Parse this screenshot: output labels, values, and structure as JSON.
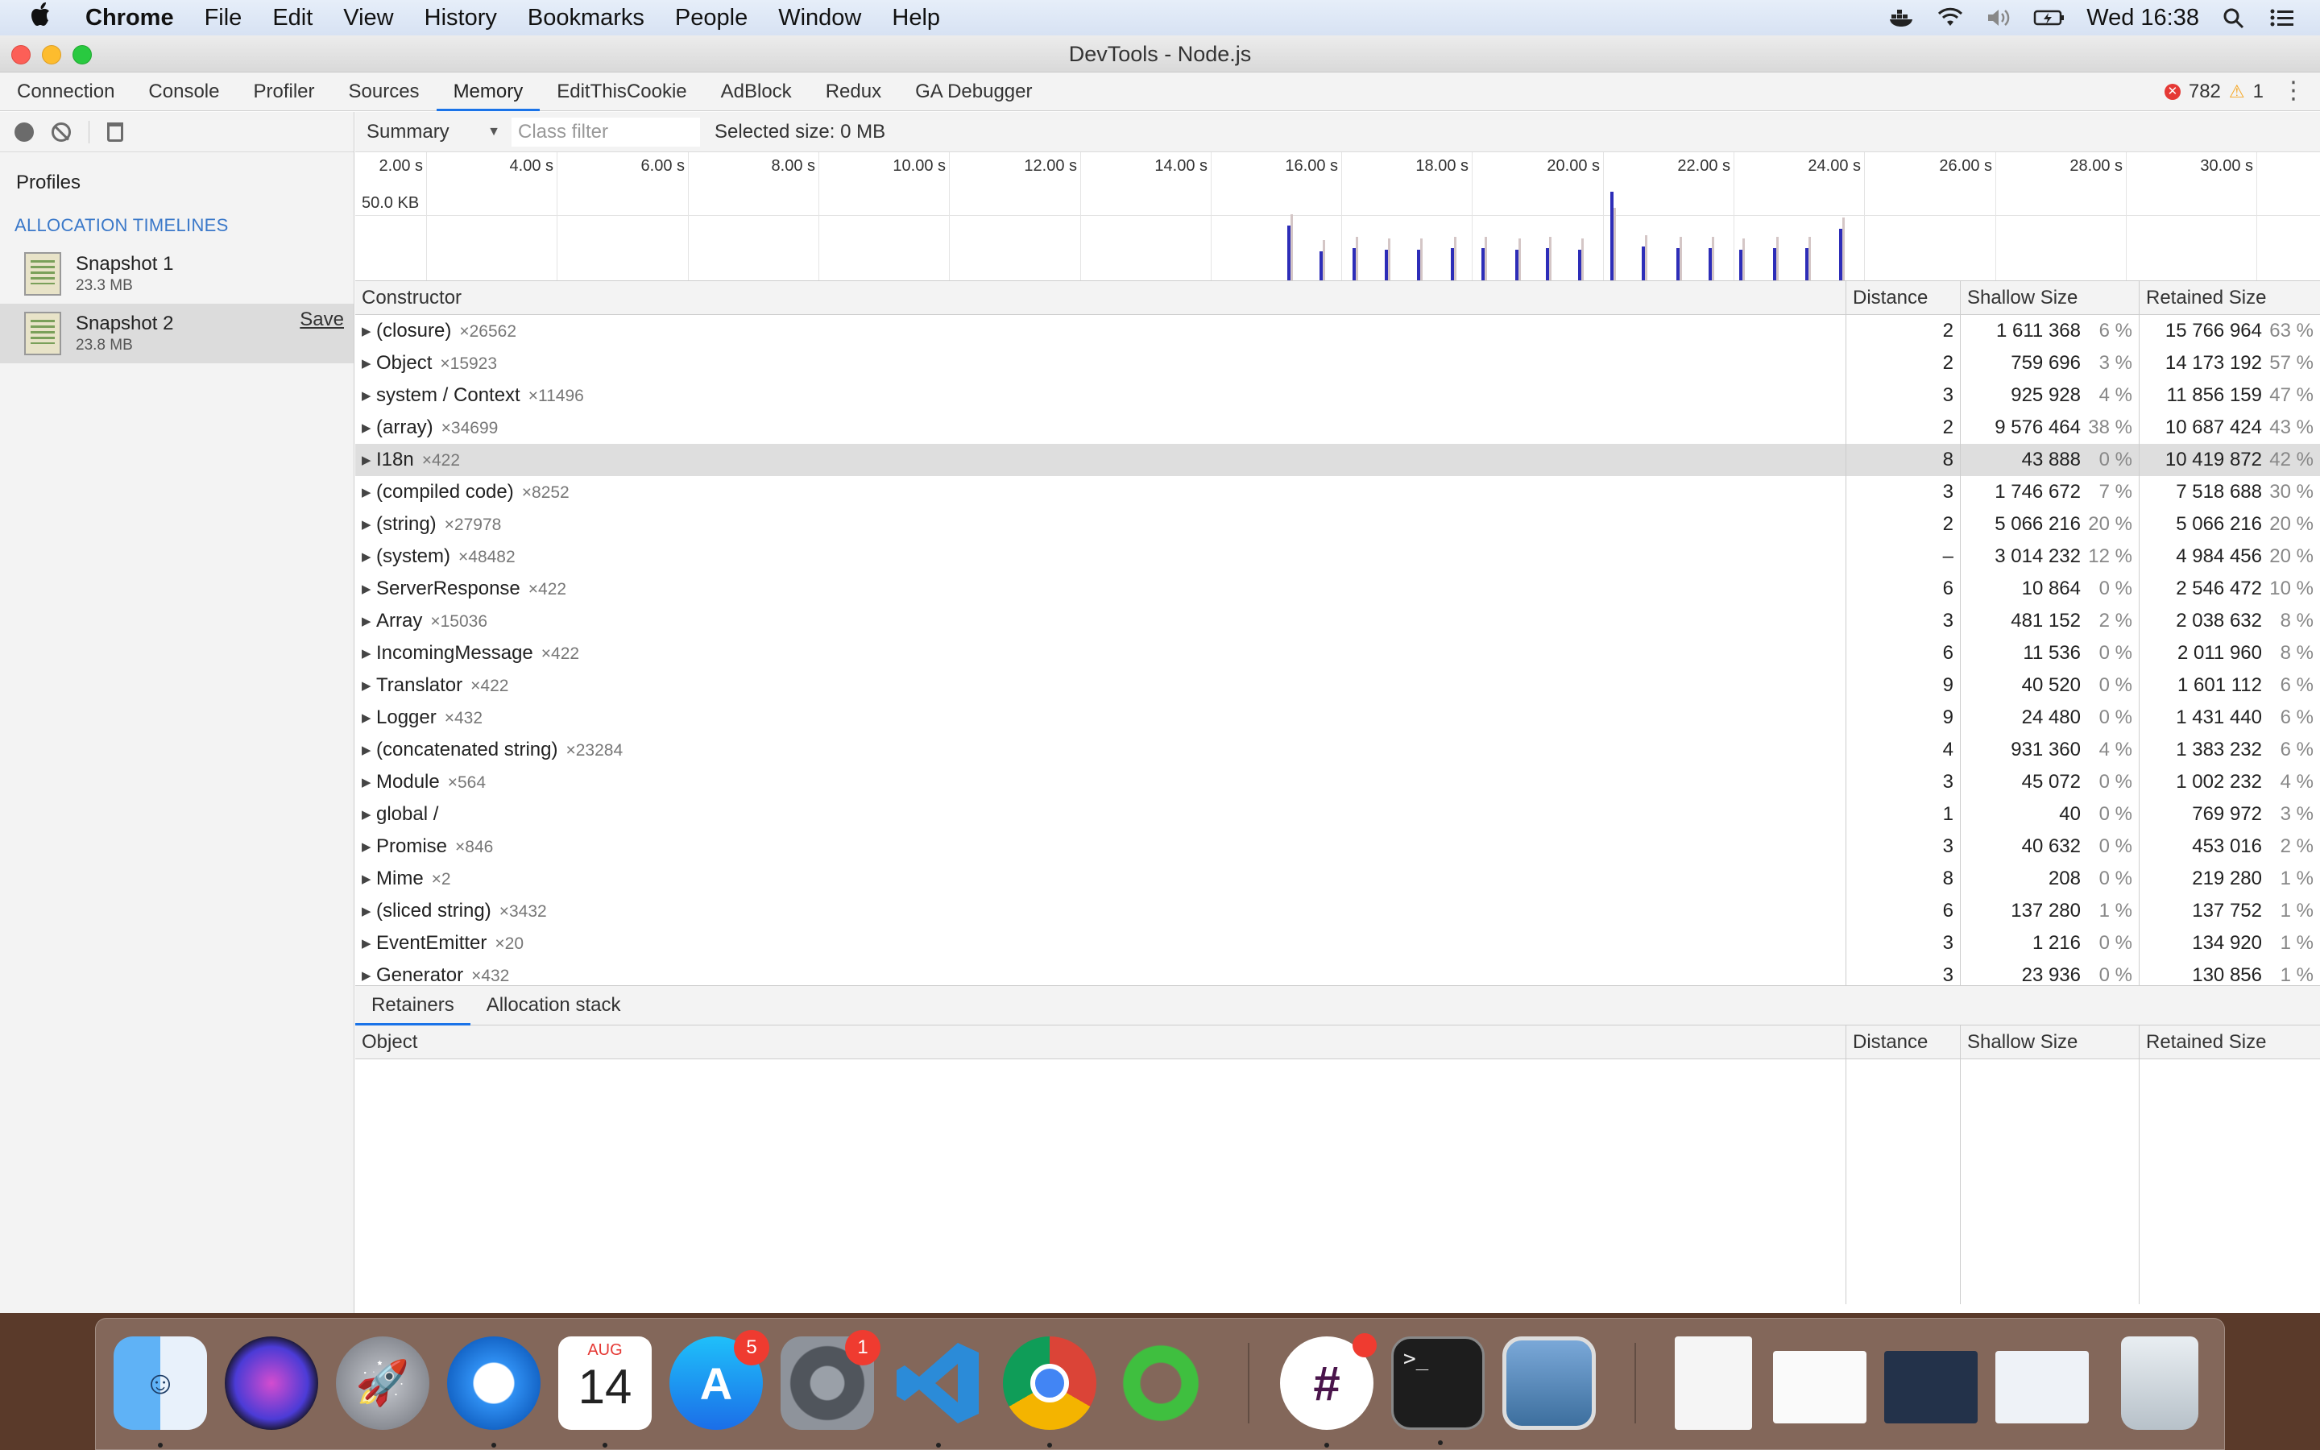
{
  "menubar": {
    "app": "Chrome",
    "items": [
      "File",
      "Edit",
      "View",
      "History",
      "Bookmarks",
      "People",
      "Window",
      "Help"
    ],
    "clock": "Wed 16:38"
  },
  "window": {
    "title": "DevTools - Node.js"
  },
  "tabs": [
    "Connection",
    "Console",
    "Profiler",
    "Sources",
    "Memory",
    "EditThisCookie",
    "AdBlock",
    "Redux",
    "GA Debugger"
  ],
  "active_tab": "Memory",
  "status": {
    "errors": "782",
    "warnings": "1"
  },
  "sidebar": {
    "profiles_label": "Profiles",
    "group_label": "ALLOCATION TIMELINES",
    "snapshots": [
      {
        "title": "Snapshot 1",
        "size": "23.3 MB"
      },
      {
        "title": "Snapshot 2",
        "size": "23.8 MB",
        "save": "Save"
      }
    ]
  },
  "toolbar": {
    "view": "Summary",
    "class_filter_placeholder": "Class filter",
    "selected_size": "Selected size: 0 MB"
  },
  "timeline": {
    "scale_label": "50.0 KB",
    "ticks": [
      "2.00 s",
      "4.00 s",
      "6.00 s",
      "8.00 s",
      "10.00 s",
      "12.00 s",
      "14.00 s",
      "16.00 s",
      "18.00 s",
      "20.00 s",
      "22.00 s",
      "24.00 s",
      "26.00 s",
      "28.00 s",
      "30.00 s"
    ]
  },
  "grid": {
    "headers": {
      "constructor": "Constructor",
      "distance": "Distance",
      "shallow": "Shallow Size",
      "retained": "Retained Size"
    },
    "rows": [
      {
        "name": "(closure)",
        "count": "×26562",
        "distance": "2",
        "shallow": "1 611 368",
        "shallow_pct": "6 %",
        "retained": "15 766 964",
        "retained_pct": "63 %"
      },
      {
        "name": "Object",
        "count": "×15923",
        "distance": "2",
        "shallow": "759 696",
        "shallow_pct": "3 %",
        "retained": "14 173 192",
        "retained_pct": "57 %"
      },
      {
        "name": "system / Context",
        "count": "×11496",
        "distance": "3",
        "shallow": "925 928",
        "shallow_pct": "4 %",
        "retained": "11 856 159",
        "retained_pct": "47 %"
      },
      {
        "name": "(array)",
        "count": "×34699",
        "distance": "2",
        "shallow": "9 576 464",
        "shallow_pct": "38 %",
        "retained": "10 687 424",
        "retained_pct": "43 %"
      },
      {
        "name": "I18n",
        "count": "×422",
        "distance": "8",
        "shallow": "43 888",
        "shallow_pct": "0 %",
        "retained": "10 419 872",
        "retained_pct": "42 %",
        "selected": true
      },
      {
        "name": "(compiled code)",
        "count": "×8252",
        "distance": "3",
        "shallow": "1 746 672",
        "shallow_pct": "7 %",
        "retained": "7 518 688",
        "retained_pct": "30 %"
      },
      {
        "name": "(string)",
        "count": "×27978",
        "distance": "2",
        "shallow": "5 066 216",
        "shallow_pct": "20 %",
        "retained": "5 066 216",
        "retained_pct": "20 %"
      },
      {
        "name": "(system)",
        "count": "×48482",
        "distance": "–",
        "shallow": "3 014 232",
        "shallow_pct": "12 %",
        "retained": "4 984 456",
        "retained_pct": "20 %"
      },
      {
        "name": "ServerResponse",
        "count": "×422",
        "distance": "6",
        "shallow": "10 864",
        "shallow_pct": "0 %",
        "retained": "2 546 472",
        "retained_pct": "10 %"
      },
      {
        "name": "Array",
        "count": "×15036",
        "distance": "3",
        "shallow": "481 152",
        "shallow_pct": "2 %",
        "retained": "2 038 632",
        "retained_pct": "8 %"
      },
      {
        "name": "IncomingMessage",
        "count": "×422",
        "distance": "6",
        "shallow": "11 536",
        "shallow_pct": "0 %",
        "retained": "2 011 960",
        "retained_pct": "8 %"
      },
      {
        "name": "Translator",
        "count": "×422",
        "distance": "9",
        "shallow": "40 520",
        "shallow_pct": "0 %",
        "retained": "1 601 112",
        "retained_pct": "6 %"
      },
      {
        "name": "Logger",
        "count": "×432",
        "distance": "9",
        "shallow": "24 480",
        "shallow_pct": "0 %",
        "retained": "1 431 440",
        "retained_pct": "6 %"
      },
      {
        "name": "(concatenated string)",
        "count": "×23284",
        "distance": "4",
        "shallow": "931 360",
        "shallow_pct": "4 %",
        "retained": "1 383 232",
        "retained_pct": "6 %"
      },
      {
        "name": "Module",
        "count": "×564",
        "distance": "3",
        "shallow": "45 072",
        "shallow_pct": "0 %",
        "retained": "1 002 232",
        "retained_pct": "4 %"
      },
      {
        "name": "global /",
        "count": "",
        "distance": "1",
        "shallow": "40",
        "shallow_pct": "0 %",
        "retained": "769 972",
        "retained_pct": "3 %"
      },
      {
        "name": "Promise",
        "count": "×846",
        "distance": "3",
        "shallow": "40 632",
        "shallow_pct": "0 %",
        "retained": "453 016",
        "retained_pct": "2 %"
      },
      {
        "name": "Mime",
        "count": "×2",
        "distance": "8",
        "shallow": "208",
        "shallow_pct": "0 %",
        "retained": "219 280",
        "retained_pct": "1 %"
      },
      {
        "name": "(sliced string)",
        "count": "×3432",
        "distance": "6",
        "shallow": "137 280",
        "shallow_pct": "1 %",
        "retained": "137 752",
        "retained_pct": "1 %"
      },
      {
        "name": "EventEmitter",
        "count": "×20",
        "distance": "3",
        "shallow": "1 216",
        "shallow_pct": "0 %",
        "retained": "134 920",
        "retained_pct": "1 %"
      },
      {
        "name": "Generator",
        "count": "×432",
        "distance": "3",
        "shallow": "23 936",
        "shallow_pct": "0 %",
        "retained": "130 856",
        "retained_pct": "1 %"
      }
    ]
  },
  "bottom": {
    "tabs": [
      "Retainers",
      "Allocation stack"
    ],
    "headers": {
      "object": "Object",
      "distance": "Distance",
      "shallow": "Shallow Size",
      "retained": "Retained Size"
    }
  },
  "dock": {
    "calendar_month": "AUG",
    "calendar_day": "14",
    "appstore_badge": "5",
    "prefs_badge": "1",
    "colors": {
      "finder": "#3b8ef0",
      "vscode": "#2b8bd8",
      "chrome_red": "#db4437",
      "chrome_yellow": "#f4b400",
      "chrome_green": "#0f9d58"
    }
  }
}
